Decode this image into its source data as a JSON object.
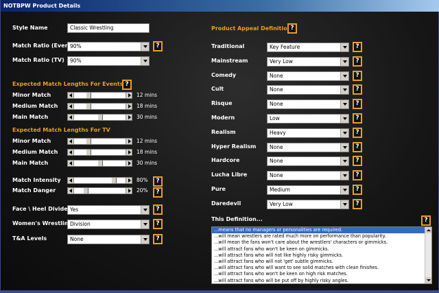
{
  "window": {
    "title": "NOTBPW Product Details"
  },
  "help_glyph": "?",
  "left": {
    "style_name": {
      "label": "Style Name",
      "value": "Classic Wrestling"
    },
    "match_ratio_event": {
      "label": "Match Ratio (Event)",
      "value": "90%"
    },
    "match_ratio_tv": {
      "label": "Match Ratio (TV)",
      "value": "90%"
    },
    "events_section": "Expected Match Lengths For Events",
    "events": [
      {
        "label": "Minor Match",
        "value": "12 mins",
        "level": 0.25
      },
      {
        "label": "Medium Match",
        "value": "18 mins",
        "level": 0.25
      },
      {
        "label": "Main Match",
        "value": "30 mins",
        "level": 0.5
      }
    ],
    "tv_section": "Expected Match Lengths For TV",
    "tv": [
      {
        "label": "Minor Match",
        "value": "12 mins",
        "level": 0.25
      },
      {
        "label": "Medium Match",
        "value": "18 mins",
        "level": 0.25
      },
      {
        "label": "Main Match",
        "value": "30 mins",
        "level": 0.5
      }
    ],
    "intensity": {
      "label": "Match Intensity",
      "value": "80%",
      "level": 0.8
    },
    "danger": {
      "label": "Match Danger",
      "value": "20%",
      "level": 0.2
    },
    "face_heel": {
      "label": "Face \\ Heel Divide",
      "value": "Yes"
    },
    "womens": {
      "label": "Women's Wrestling",
      "value": "Division"
    },
    "ta": {
      "label": "T&A Levels",
      "value": "None"
    }
  },
  "right": {
    "section": "Product Appeal Definition",
    "appeals": [
      {
        "label": "Traditional",
        "value": "Key Feature"
      },
      {
        "label": "Mainstream",
        "value": "Very Low"
      },
      {
        "label": "Comedy",
        "value": "None"
      },
      {
        "label": "Cult",
        "value": "None"
      },
      {
        "label": "Risque",
        "value": "None"
      },
      {
        "label": "Modern",
        "value": "Low"
      },
      {
        "label": "Realism",
        "value": "Heavy"
      },
      {
        "label": "Hyper Realism",
        "value": "None"
      },
      {
        "label": "Hardcore",
        "value": "None"
      },
      {
        "label": "Lucha Libre",
        "value": "None"
      },
      {
        "label": "Pure",
        "value": "Medium"
      },
      {
        "label": "Daredevil",
        "value": "Very Low"
      }
    ],
    "definition_label": "This Definition...",
    "definition_lines": [
      "...means that no managers or personalities are required.",
      "...will mean wrestlers are rated much more on performance than popularity.",
      "...will mean the fans won't care about the wrestlers' characters or gimmicks.",
      "...will attract fans who won't be keen on gimmicks.",
      "...will attract fans who will not like highly risky gimmicks.",
      "...will attract fans who will not 'get' subtle gimmicks.",
      "...will attract fans who will want to see solid matches with clean finishes.",
      "...will attract fans who won't be keen on high risk matches.",
      "...will attract fans who will be put off by highly risky angles."
    ]
  }
}
